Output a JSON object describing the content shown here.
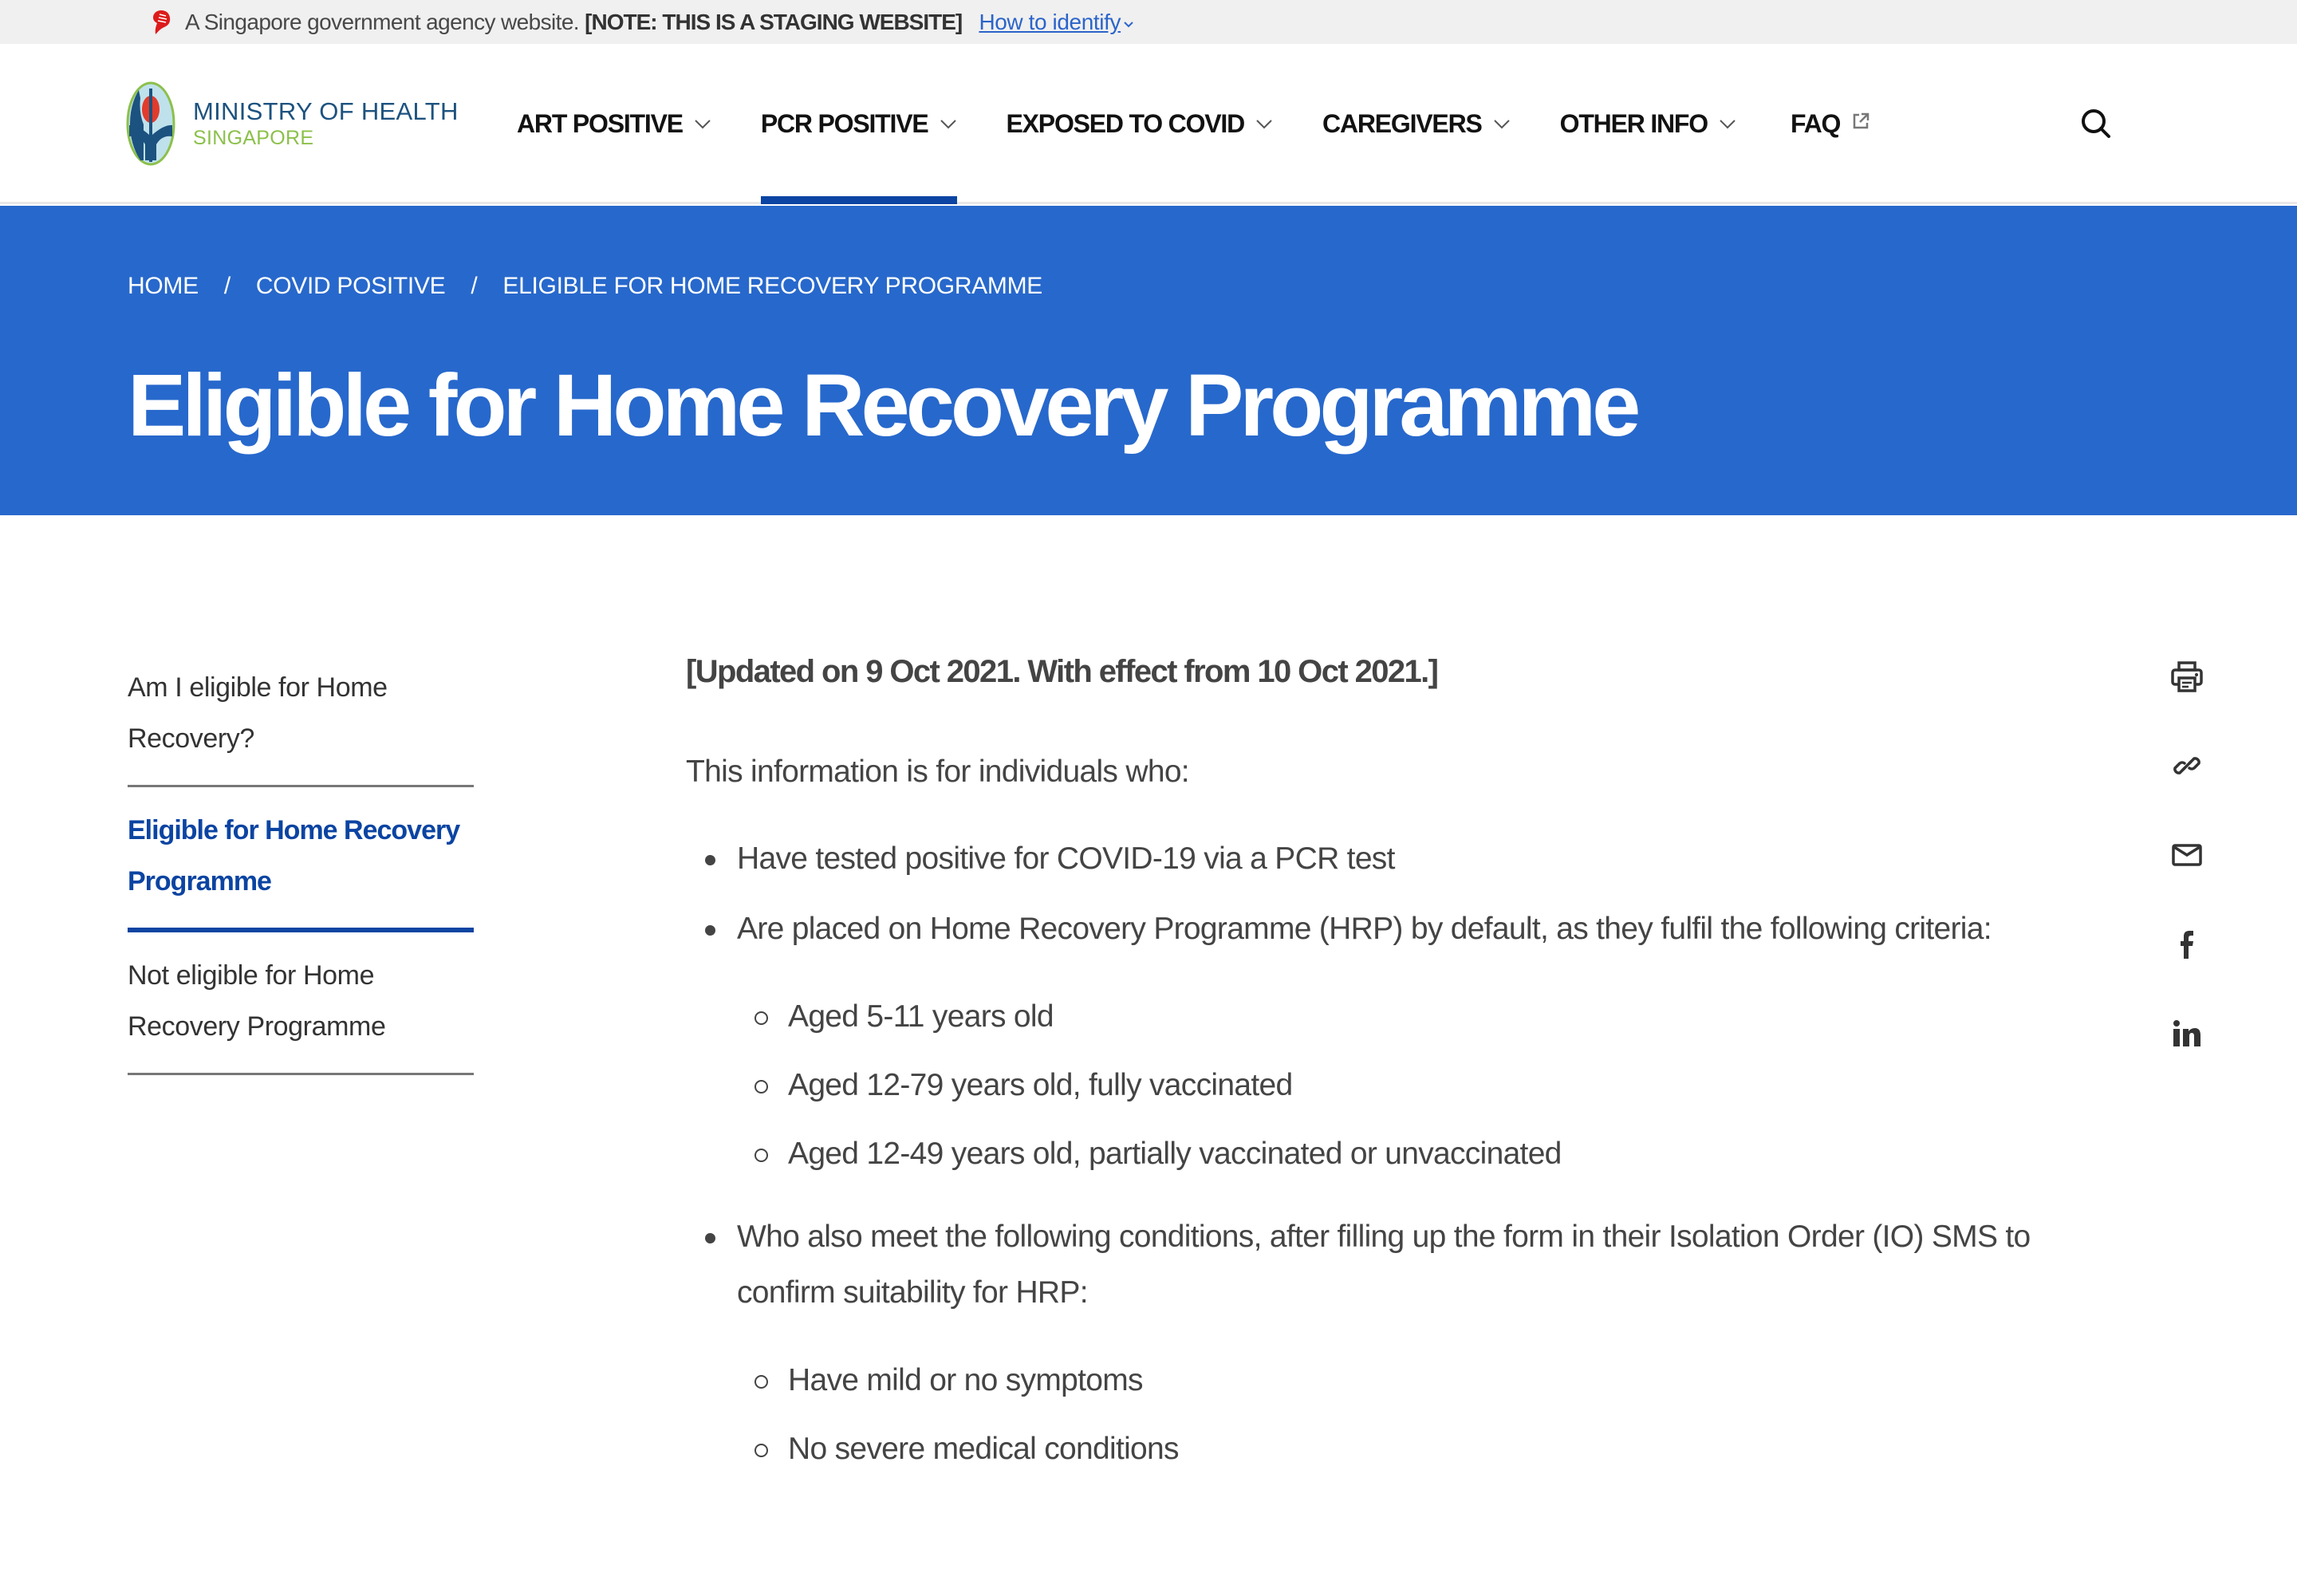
{
  "masthead": {
    "text": "A Singapore government agency website.",
    "note": "[NOTE: THIS IS A STAGING WEBSITE]",
    "link": "How to identify",
    "crest_icon": "lion-head-crest-icon"
  },
  "header": {
    "logo": {
      "title": "MINISTRY OF HEALTH",
      "subtitle": "SINGAPORE"
    },
    "nav": [
      {
        "label": "ART POSITIVE",
        "has_dropdown": true,
        "active": false
      },
      {
        "label": "PCR POSITIVE",
        "has_dropdown": true,
        "active": true
      },
      {
        "label": "EXPOSED TO COVID",
        "has_dropdown": true,
        "active": false
      },
      {
        "label": "CAREGIVERS",
        "has_dropdown": true,
        "active": false
      },
      {
        "label": "OTHER INFO",
        "has_dropdown": true,
        "active": false
      },
      {
        "label": "FAQ",
        "external": true,
        "active": false
      }
    ],
    "search_icon": "search-icon"
  },
  "hero": {
    "breadcrumb": [
      "HOME",
      "COVID POSITIVE",
      "ELIGIBLE FOR HOME RECOVERY PROGRAMME"
    ],
    "separator": "/",
    "title": "Eligible for Home Recovery Programme"
  },
  "sidebar": {
    "items": [
      {
        "label": "Am I eligible for Home Recovery?",
        "active": false
      },
      {
        "label": "Eligible for Home Recovery Programme",
        "active": true
      },
      {
        "label": "Not eligible for Home Recovery Programme",
        "active": false
      }
    ]
  },
  "content": {
    "updated": "[Updated on 9 Oct 2021. With effect from 10 Oct 2021.]",
    "intro": "This information is for individuals who:",
    "bullets": [
      {
        "text": "Have tested positive for COVID-19 via a PCR test",
        "sub": []
      },
      {
        "text": "Are placed on Home Recovery Programme (HRP) by default, as they fulfil the following criteria:",
        "sub": [
          "Aged 5-11 years old",
          "Aged 12-79 years old, fully vaccinated",
          "Aged 12-49 years old, partially vaccinated or unvaccinated"
        ]
      },
      {
        "text": "Who also meet the following conditions, after filling up the form in their Isolation Order (IO) SMS to confirm suitability for HRP:",
        "sub": [
          "Have mild or no symptoms",
          "No severe medical conditions"
        ]
      }
    ]
  },
  "share": [
    "print-icon",
    "copy-link-icon",
    "email-icon",
    "facebook-icon",
    "linkedin-icon"
  ],
  "colors": {
    "hero_bg": "#2768cc",
    "active_blue": "#0b44a2",
    "link_blue": "#2b64c9",
    "logo_blue": "#1c527f",
    "logo_green": "#8cc04b",
    "masthead_bg": "#f0f0f0"
  }
}
